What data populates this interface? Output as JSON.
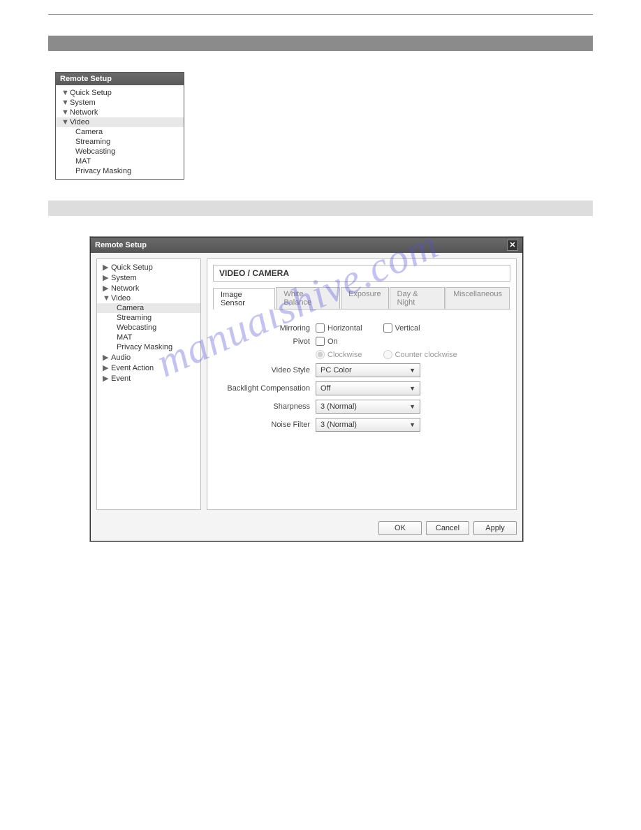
{
  "watermark": "manualshive.com",
  "panel1": {
    "title": "Remote Setup",
    "tree": {
      "quick_setup": "Quick Setup",
      "system": "System",
      "network": "Network",
      "video": "Video",
      "video_children": {
        "camera": "Camera",
        "streaming": "Streaming",
        "webcasting": "Webcasting",
        "mat": "MAT",
        "privacy_masking": "Privacy Masking"
      }
    }
  },
  "dialog": {
    "title": "Remote Setup",
    "tree": {
      "quick_setup": "Quick Setup",
      "system": "System",
      "network": "Network",
      "video": "Video",
      "video_children": {
        "camera": "Camera",
        "streaming": "Streaming",
        "webcasting": "Webcasting",
        "mat": "MAT",
        "privacy_masking": "Privacy Masking"
      },
      "audio": "Audio",
      "event_action": "Event Action",
      "event": "Event"
    },
    "content_title": "VIDEO / CAMERA",
    "tabs": {
      "image_sensor": "Image Sensor",
      "white_balance": "White Balance",
      "exposure": "Exposure",
      "day_night": "Day & Night",
      "miscellaneous": "Miscellaneous"
    },
    "form": {
      "mirroring_label": "Mirroring",
      "horizontal": "Horizontal",
      "vertical": "Vertical",
      "pivot_label": "Pivot",
      "on": "On",
      "clockwise": "Clockwise",
      "counter_clockwise": "Counter clockwise",
      "video_style_label": "Video Style",
      "video_style_value": "PC Color",
      "backlight_label": "Backlight Compensation",
      "backlight_value": "Off",
      "sharpness_label": "Sharpness",
      "sharpness_value": "3 (Normal)",
      "noise_filter_label": "Noise Filter",
      "noise_filter_value": "3 (Normal)"
    },
    "buttons": {
      "ok": "OK",
      "cancel": "Cancel",
      "apply": "Apply"
    }
  }
}
